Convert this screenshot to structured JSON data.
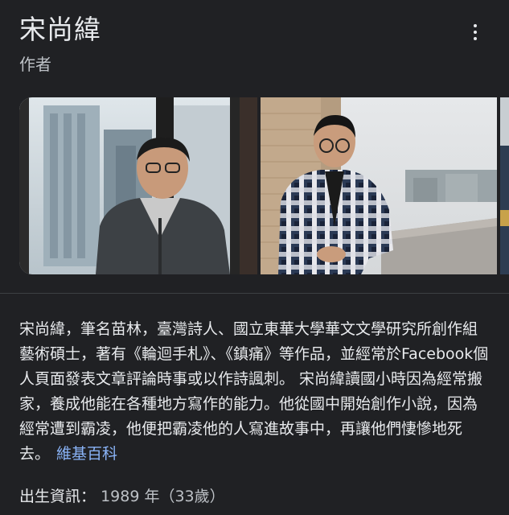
{
  "entity": {
    "title": "宋尚緯",
    "subtitle": "作者"
  },
  "menu": {
    "icon": "more-vert-icon"
  },
  "gallery": {
    "images": [
      {
        "name": "author-photo-window"
      },
      {
        "name": "author-photo-rooftop"
      },
      {
        "name": "author-photo-partial"
      }
    ]
  },
  "description": {
    "text": "宋尚緯，筆名苗林，臺灣詩人、國立東華大學華文文學研究所創作組藝術碩士，著有《輪迴手札》、《鎮痛》等作品，並經常於Facebook個人頁面發表文章評論時事或以作詩諷刺。 宋尚緯讀國小時因為經常搬家，養成他能在各種地方寫作的能力。他從國中開始創作小說，因為經常遭到霸凌，他便把霸凌他的人寫進故事中，再讓他們悽慘地死去。",
    "source_label": "維基百科"
  },
  "born": {
    "label": "出生資訊：",
    "value": "1989 年（33歲）"
  },
  "colors": {
    "background": "#202124",
    "text_primary": "#e8eaed",
    "text_secondary": "#bdc1c6",
    "link": "#8ab4f8",
    "divider": "#3c4043"
  }
}
